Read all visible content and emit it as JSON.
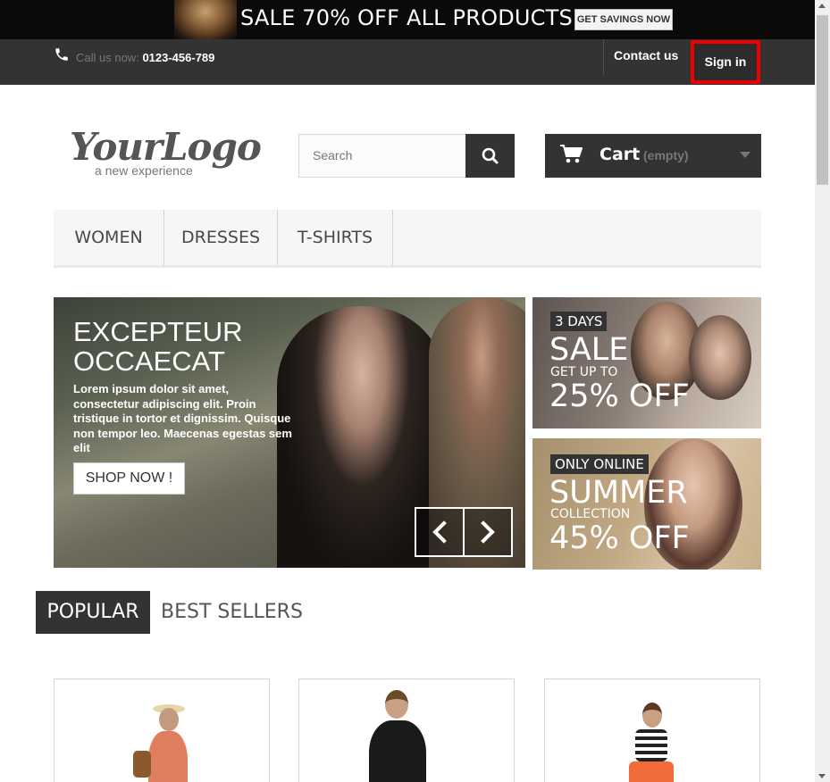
{
  "banner": {
    "text": "SALE 70% OFF ALL PRODUCTS",
    "button_label": "GET SAVINGS NOW"
  },
  "topbar": {
    "call_label": "Call us now:",
    "phone": "0123-456-789",
    "contact_label": "Contact us",
    "signin_label": "Sign in"
  },
  "header": {
    "logo_main": "YourLogo",
    "logo_sub": "a new experience",
    "search_placeholder": "Search",
    "cart_label": "Cart",
    "cart_status": "(empty)"
  },
  "menu": {
    "items": [
      {
        "label": "WOMEN"
      },
      {
        "label": "DRESSES"
      },
      {
        "label": "T-SHIRTS"
      }
    ]
  },
  "slider": {
    "title_line1": "EXCEPTEUR",
    "title_line2": "OCCAECAT",
    "description": "Lorem ipsum dolor sit amet, consectetur adipiscing elit. Proin tristique in tortor et dignissim. Quisque non tempor leo. Maecenas egestas sem elit",
    "button_label": "SHOP NOW !"
  },
  "promos": [
    {
      "tag": "3 DAYS",
      "big1": "SALE",
      "small": "GET UP TO",
      "big2": "25% OFF"
    },
    {
      "tag": "ONLY ONLINE",
      "big1": "SUMMER",
      "small": "COLLECTION",
      "big2": "45% OFF"
    }
  ],
  "tabs": {
    "popular": "POPULAR",
    "best_sellers": "BEST SELLERS"
  },
  "colors": {
    "dark": "#333333",
    "highlight": "#ee0000",
    "menu_bg": "#f6f6f6"
  }
}
